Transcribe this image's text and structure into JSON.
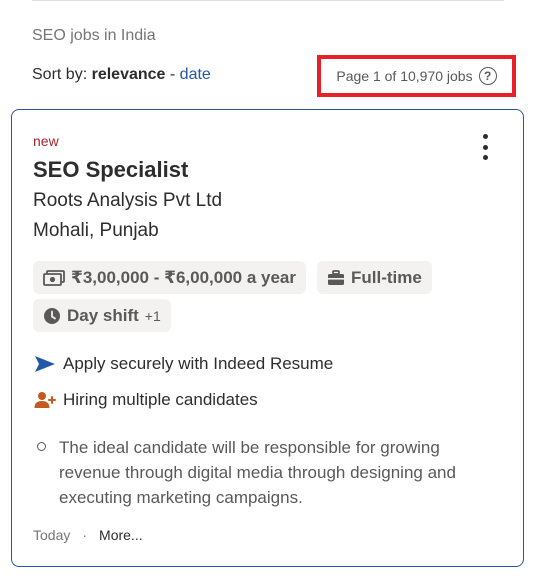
{
  "search_title": "SEO jobs in India",
  "sort": {
    "prefix": "Sort by:",
    "active": "relevance",
    "separator": "-",
    "alternate": "date"
  },
  "pagination": {
    "text": "Page 1 of 10,970 jobs",
    "help_icon": "question-circle-icon",
    "highlight_color": "#e8202a"
  },
  "job": {
    "badge": "new",
    "title": "SEO Specialist",
    "company": "Roots Analysis Pvt Ltd",
    "location": "Mohali, Punjab",
    "salary": "₹3,00,000 - ₹6,00,000 a year",
    "job_type": "Full-time",
    "shift": "Day shift",
    "shift_extra": "+1",
    "apply_text": "Apply securely with Indeed Resume",
    "hiring_text": "Hiring multiple candidates",
    "snippet": "The ideal candidate will be responsible for growing revenue through digital media through designing and executing marketing campaigns.",
    "posted": "Today",
    "footer_separator": "·",
    "more": "More..."
  },
  "colors": {
    "accent": "#2557a7",
    "new_badge": "#a9252b",
    "hiring_icon": "#c45a1f"
  }
}
